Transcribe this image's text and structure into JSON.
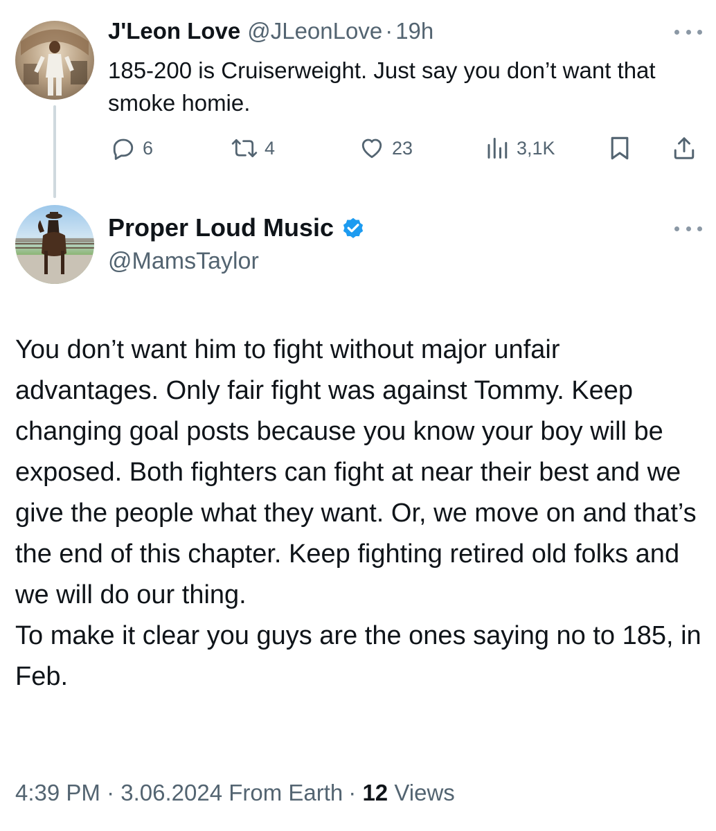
{
  "reply_parent": {
    "display_name": "J'Leon Love",
    "handle": "@JLeonLove",
    "separator": "·",
    "time_ago": "19h",
    "text": "185-200 is Cruiserweight. Just say you don’t want that smoke homie.",
    "actions": {
      "replies": "6",
      "reposts": "4",
      "likes": "23",
      "views": "3,1K"
    },
    "more_icon": "more-horizontal-icon"
  },
  "main_tweet": {
    "display_name": "Proper Loud Music",
    "verified_icon": "verified-badge-icon",
    "handle": "@MamsTaylor",
    "more_icon": "more-horizontal-icon",
    "text_lines": [
      "You don’t want him to fight without major unfair advantages. Only fair fight was against Tommy. Keep changing goal posts because you know your boy will be exposed. Both fighters can fight at near their best and we give the people what they want. Or, we move on and that’s the end of this chapter. Keep fighting retired old folks and we will do our thing.",
      "To make it clear you guys are the ones saying no to 185, in Feb."
    ],
    "timestamp": "4:39 PM",
    "separator": "·",
    "date": "3.06.2024",
    "source": "From Earth",
    "views_count": "12",
    "views_label": "Views"
  },
  "colors": {
    "text_primary": "#0f1419",
    "text_secondary": "#536471",
    "verified_blue": "#1d9bf0",
    "thread_line": "#cfd9de"
  }
}
